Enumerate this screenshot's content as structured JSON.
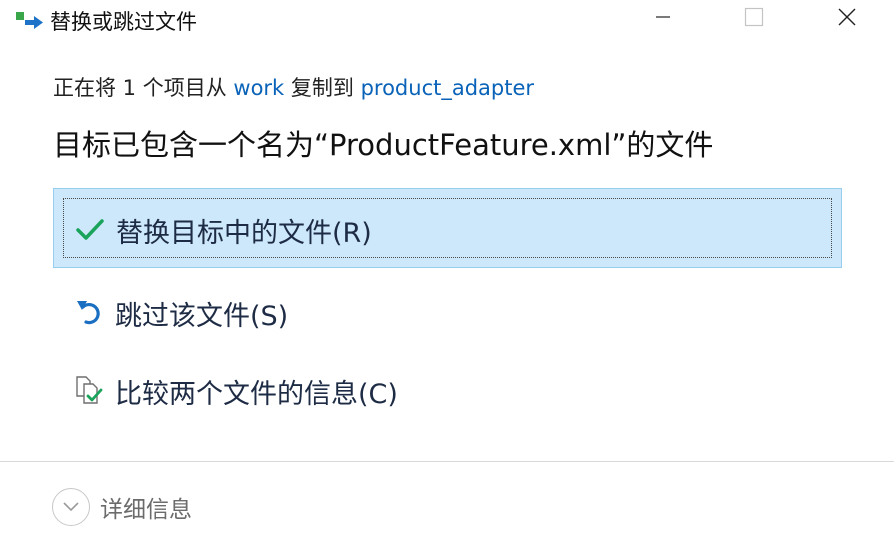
{
  "window": {
    "title": "替换或跳过文件",
    "icons": {
      "app": "copy-move-icon",
      "minimize": "minimize-icon",
      "maximize": "maximize-icon",
      "close": "close-icon"
    }
  },
  "copy_info": {
    "prefix": "正在将 1 个项目从 ",
    "source": "work",
    "middle": " 复制到 ",
    "destination": "product_adapter"
  },
  "heading": "目标已包含一个名为“ProductFeature.xml”的文件",
  "options": [
    {
      "label": "替换目标中的文件(R)",
      "icon": "checkmark-icon",
      "selected": true
    },
    {
      "label": "跳过该文件(S)",
      "icon": "undo-arrow-icon",
      "selected": false
    },
    {
      "label": "比较两个文件的信息(C)",
      "icon": "compare-files-icon",
      "selected": false
    }
  ],
  "details": {
    "label": "详细信息",
    "icon": "chevron-down-icon"
  },
  "colors": {
    "link": "#0a63b8",
    "selected_bg": "#cde8fb",
    "selected_border": "#99cdee",
    "check": "#1aa35b",
    "undo": "#1b6fc2"
  }
}
